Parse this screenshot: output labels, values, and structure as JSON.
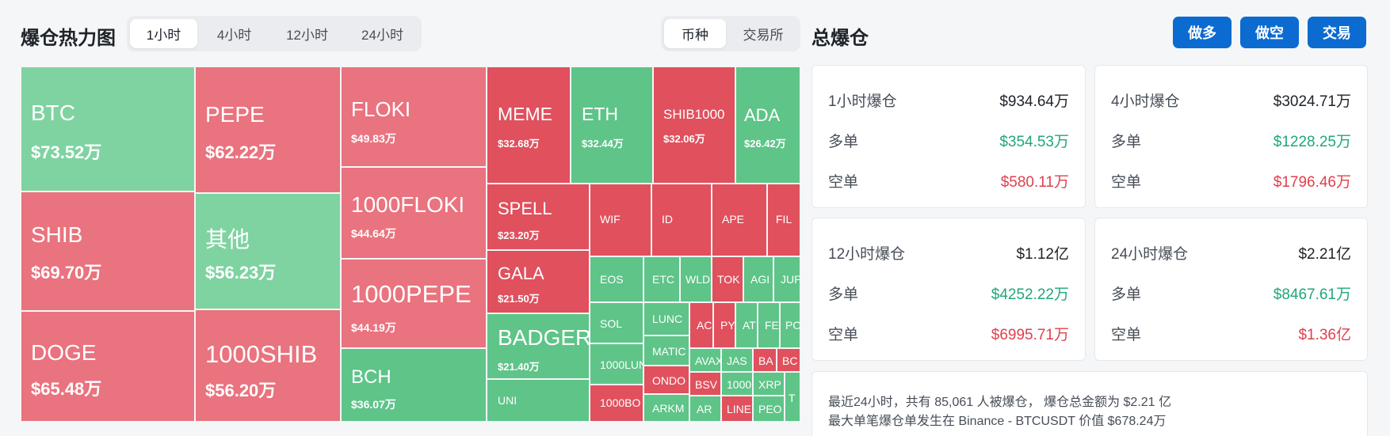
{
  "header": {
    "title": "爆仓热力图",
    "timeframes": [
      "1小时",
      "4小时",
      "12小时",
      "24小时"
    ],
    "active_timeframe": "1小时",
    "groupings": [
      "币种",
      "交易所"
    ],
    "active_grouping": "币种"
  },
  "summary_panel": {
    "title": "总爆仓",
    "buttons": [
      "做多",
      "做空",
      "交易"
    ],
    "long_label": "多单",
    "short_label": "空单",
    "cards": [
      {
        "label": "1小时爆仓",
        "total": "$934.64万",
        "long": "$354.53万",
        "short": "$580.11万"
      },
      {
        "label": "4小时爆仓",
        "total": "$3024.71万",
        "long": "$1228.25万",
        "short": "$1796.46万"
      },
      {
        "label": "12小时爆仓",
        "total": "$1.12亿",
        "long": "$4252.22万",
        "short": "$6995.71万"
      },
      {
        "label": "24小时爆仓",
        "total": "$2.21亿",
        "long": "$8467.61万",
        "short": "$1.36亿"
      }
    ],
    "note_line1": "最近24小时，共有 85,061 人被爆仓， 爆仓总金额为 $2.21 亿",
    "note_line2": "最大单笔爆仓单发生在 Binance - BTCUSDT 价值 $678.24万"
  },
  "colors": {
    "long_green": "#5ec488",
    "short_red": "#e0505d",
    "accent_blue": "#0b6bd0"
  },
  "heatmap": [
    {
      "name": "BTC",
      "value": "$73.52万"
    },
    {
      "name": "SHIB",
      "value": "$69.70万"
    },
    {
      "name": "DOGE",
      "value": "$65.48万"
    },
    {
      "name": "PEPE",
      "value": "$62.22万"
    },
    {
      "name": "其他",
      "value": "$56.23万"
    },
    {
      "name": "1000SHIB",
      "value": "$56.20万"
    },
    {
      "name": "FLOKI",
      "value": "$49.83万"
    },
    {
      "name": "1000FLOKI",
      "value": "$44.64万"
    },
    {
      "name": "1000PEPE",
      "value": "$44.19万"
    },
    {
      "name": "BCH",
      "value": "$36.07万"
    },
    {
      "name": "MEME",
      "value": "$32.68万"
    },
    {
      "name": "ETH",
      "value": "$32.44万"
    },
    {
      "name": "SHIB1000",
      "value": "$32.06万"
    },
    {
      "name": "ADA",
      "value": "$26.42万"
    },
    {
      "name": "SPELL",
      "value": "$23.20万"
    },
    {
      "name": "GALA",
      "value": "$21.50万"
    },
    {
      "name": "BADGER",
      "value": "$21.40万"
    },
    {
      "name": "UNI"
    },
    {
      "name": "WIF"
    },
    {
      "name": "ID"
    },
    {
      "name": "APE"
    },
    {
      "name": "FIL"
    },
    {
      "name": "EOS"
    },
    {
      "name": "ETC"
    },
    {
      "name": "WLD"
    },
    {
      "name": "TOK"
    },
    {
      "name": "AGI"
    },
    {
      "name": "JUP"
    },
    {
      "name": "SOL"
    },
    {
      "name": "LUNC"
    },
    {
      "name": "AC"
    },
    {
      "name": "PY"
    },
    {
      "name": "AT"
    },
    {
      "name": "FE"
    },
    {
      "name": "PO"
    },
    {
      "name": "1000LUN"
    },
    {
      "name": "MATIC"
    },
    {
      "name": "AVAX"
    },
    {
      "name": "JAS"
    },
    {
      "name": "BA"
    },
    {
      "name": "BC"
    },
    {
      "name": "ONDO"
    },
    {
      "name": "BSV"
    },
    {
      "name": "1000"
    },
    {
      "name": "XRP"
    },
    {
      "name": "1000BO"
    },
    {
      "name": "ARKM"
    },
    {
      "name": "AR"
    },
    {
      "name": "LINE"
    },
    {
      "name": "PEO"
    },
    {
      "name": "T"
    }
  ]
}
